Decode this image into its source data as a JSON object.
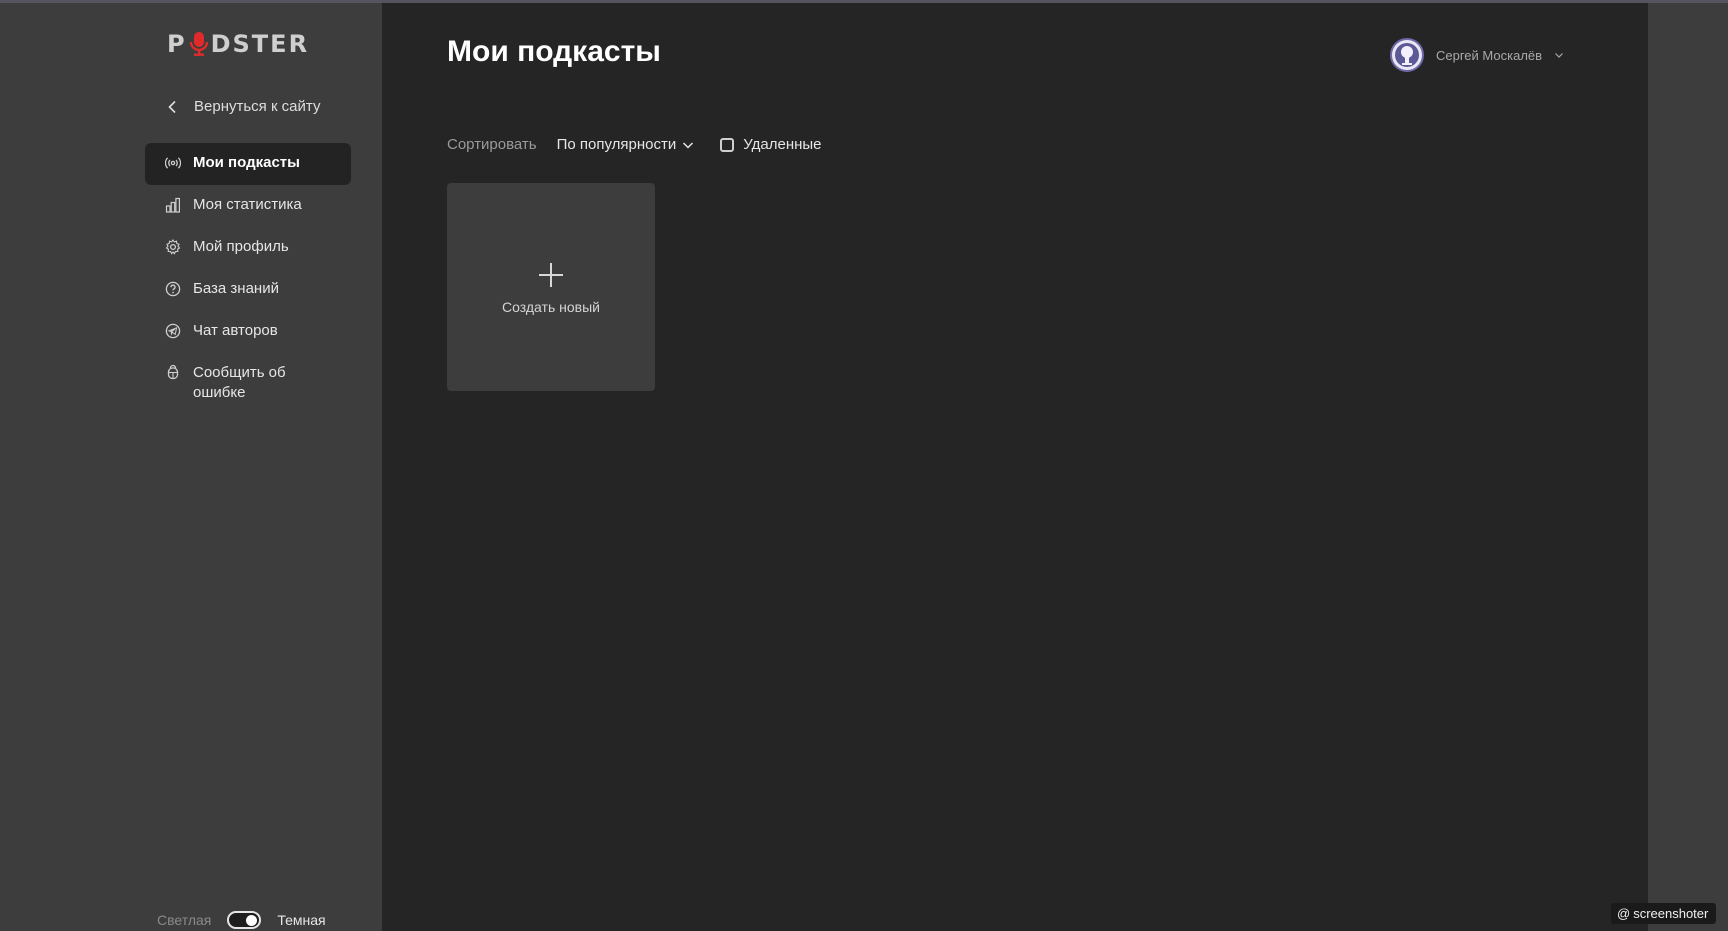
{
  "brand": {
    "logo_text_left": "P",
    "logo_text_right": "DSTER",
    "accent": "#e02b2b"
  },
  "sidebar": {
    "back_label": "Вернуться к сайту",
    "items": [
      {
        "label": "Мои подкасты",
        "icon": "broadcast-icon",
        "active": true
      },
      {
        "label": "Моя статистика",
        "icon": "bar-chart-icon"
      },
      {
        "label": "Мой профиль",
        "icon": "gear-icon"
      },
      {
        "label": "База знаний",
        "icon": "question-circle-icon"
      },
      {
        "label": "Чат авторов",
        "icon": "telegram-icon"
      },
      {
        "label": "Сообщить об ошибке",
        "icon": "bug-icon"
      }
    ],
    "theme": {
      "light_label": "Светлая",
      "dark_label": "Темная",
      "dark_enabled": true
    }
  },
  "header": {
    "title": "Мои подкасты",
    "user": {
      "name": "Сергей Москалёв"
    }
  },
  "toolbar": {
    "sort_label": "Сортировать",
    "sort_value": "По популярности",
    "deleted_label": "Удаленные",
    "deleted_checked": false
  },
  "create_card": {
    "label": "Создать новый"
  },
  "watermark": {
    "label": "screenshoter"
  }
}
